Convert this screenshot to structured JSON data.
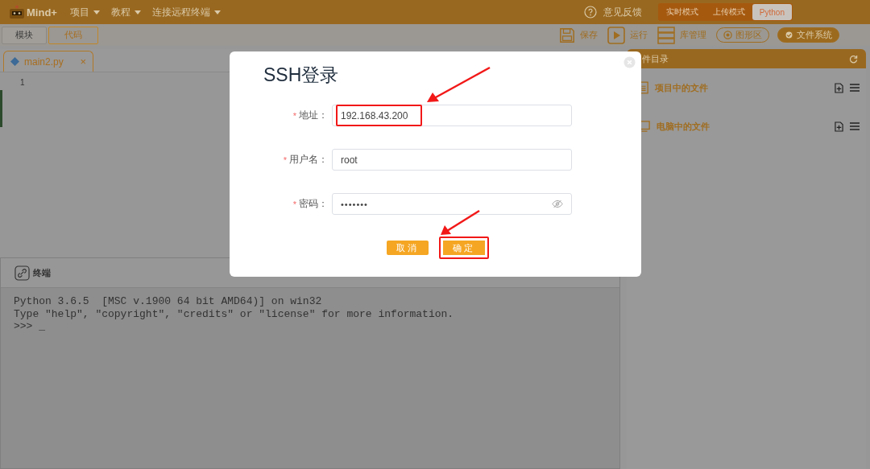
{
  "topbar": {
    "logo": "Mind+",
    "menus": [
      "项目",
      "教程",
      "连接远程终端"
    ],
    "feedback": "意见反馈",
    "modes": [
      {
        "label": "实时模式",
        "selected": false
      },
      {
        "label": "上传模式",
        "selected": false
      },
      {
        "label": "Python",
        "selected": true
      }
    ]
  },
  "toolbar": {
    "tabs": [
      {
        "label": "模块",
        "selected": false
      },
      {
        "label": "代码",
        "selected": true
      }
    ],
    "actions": [
      {
        "label": "保存",
        "kind": "save"
      },
      {
        "label": "运行",
        "kind": "run"
      },
      {
        "label": "库管理",
        "kind": "library"
      },
      {
        "label": "图形区",
        "kind": "pill",
        "selected": false
      },
      {
        "label": "文件系统",
        "kind": "pill",
        "selected": true
      }
    ]
  },
  "editor": {
    "file_tab": {
      "name": "main2.py",
      "close": "×"
    },
    "line_numbers": [
      "1"
    ]
  },
  "terminal": {
    "title": "终端",
    "lines": [
      "Python 3.6.5  [MSC v.1900 64 bit AMD64)] on win32",
      "Type \"help\", \"copyright\", \"credits\" or \"license\" for more information.",
      ">>> _"
    ]
  },
  "file_panel": {
    "title": "件目录",
    "sections": [
      {
        "label": "项目中的文件",
        "kind": "project"
      },
      {
        "label": "电脑中的文件",
        "kind": "computer"
      }
    ]
  },
  "dialog": {
    "title": "SSH登录",
    "fields": [
      {
        "mark": "*",
        "label": "地址：",
        "value": "192.168.43.200",
        "kind": "text",
        "highlighted": true
      },
      {
        "mark": "*",
        "label": "用户名：",
        "value": "root",
        "kind": "text",
        "highlighted": false
      },
      {
        "mark": "*",
        "label": "密码：",
        "value": "•••••••",
        "kind": "password",
        "highlighted": false
      }
    ],
    "buttons": [
      {
        "label": "取消",
        "highlighted": false
      },
      {
        "label": "确定",
        "highlighted": true
      }
    ]
  }
}
